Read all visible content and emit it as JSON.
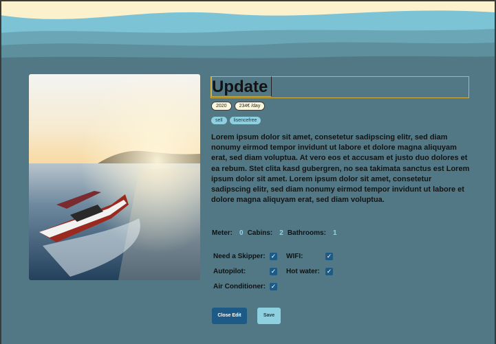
{
  "listing": {
    "title": "Update",
    "tags": [
      "2020",
      "234€ /day"
    ],
    "categories": [
      "sell",
      "lisencefree"
    ],
    "description": "Lorem ipsum dolor sit amet, consetetur sadipscing elitr, sed diam nonumy eirmod tempor invidunt ut labore et dolore magna aliquyam erat, sed diam voluptua. At vero eos et accusam et justo duo dolores et ea rebum. Stet clita kasd gubergren, no sea takimata sanctus est Lorem ipsum dolor sit amet. Lorem ipsum dolor sit amet, consetetur sadipscing elitr, sed diam nonumy eirmod tempor invidunt ut labore et dolore magna aliquyam erat, sed diam voluptua."
  },
  "stats": [
    {
      "label": "Meter:",
      "value": "0"
    },
    {
      "label": "Cabins:",
      "value": "2"
    },
    {
      "label": "Bathrooms:",
      "value": "1"
    }
  ],
  "features": {
    "skipper": {
      "label": "Need a Skipper:",
      "checked": true
    },
    "wifi": {
      "label": "WIFI:",
      "checked": true
    },
    "autopilot": {
      "label": "Autopilot:",
      "checked": true
    },
    "hotwater": {
      "label": "Hot water:",
      "checked": true
    },
    "aircon": {
      "label": "Air Conditioner:",
      "checked": true
    }
  },
  "buttons": {
    "close_edit": "Close Edit",
    "save": "Save"
  },
  "colors": {
    "background": "#527885",
    "primary_button": "#1d5a86",
    "secondary_button": "#8fd0e0",
    "focus_border": "#d8b23c"
  }
}
